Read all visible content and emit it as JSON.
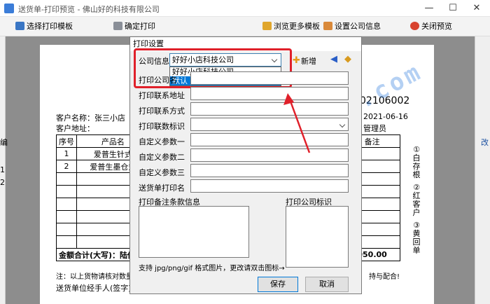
{
  "window": {
    "title": "送货单-打印预览 - 佛山好的科技有限公司",
    "minimize": "—",
    "maximize": "☐",
    "close": "✕"
  },
  "toolbar": {
    "select_template": "选择打印模板",
    "confirm_print": "确定打印",
    "browse_templates": "浏览更多模板",
    "company_settings": "设置公司信息",
    "close_preview": "关闭预览"
  },
  "document": {
    "number": "02106002",
    "customer_name": "客户名称：张三小店",
    "customer_address": "客户地址：",
    "date": "2021-06-16",
    "operator": "管理员",
    "headers": [
      "序号",
      "产品名",
      "备注"
    ],
    "rows": [
      {
        "no": "1",
        "product": "爱普生针式"
      },
      {
        "no": "2",
        "product": "爱普生墨仓式"
      }
    ],
    "total_label": "金额合计(大写)：陆仟",
    "total_amount": "050.00",
    "note": "注：以上货物请核对数量",
    "note_tail": "持与配合!",
    "signature": "送货单位经手人(签字)",
    "stubs": [
      "①白存根",
      "②红客户",
      "③黄回单"
    ],
    "left_fragments": [
      "编",
      "1",
      "2"
    ],
    "right_fragment": "改"
  },
  "watermark": "www.haoded.com",
  "dialog": {
    "title": "打印设置",
    "company_label": "公司信息",
    "company_selected": "好好小店科技公司",
    "company_options": [
      "好好小店科技公司",
      "默认"
    ],
    "new_label": "新增",
    "fields": [
      {
        "label": "打印公司名"
      },
      {
        "label": "打印联系地址"
      },
      {
        "label": "打印联系方式"
      },
      {
        "label": "打印联数标识"
      },
      {
        "label": "自定义参数一"
      },
      {
        "label": "自定义参数二"
      },
      {
        "label": "自定义参数三"
      },
      {
        "label": "送货单打印名"
      }
    ],
    "remarks_label": "打印备注条款信息",
    "logo_label": "打印公司标识",
    "hint": "支持 jpg/png/gif 格式图片，更改请双击图标→",
    "save": "保存",
    "cancel": "取消"
  },
  "colors": {
    "highlight": "#e0202a",
    "accent": "#0078d7"
  }
}
